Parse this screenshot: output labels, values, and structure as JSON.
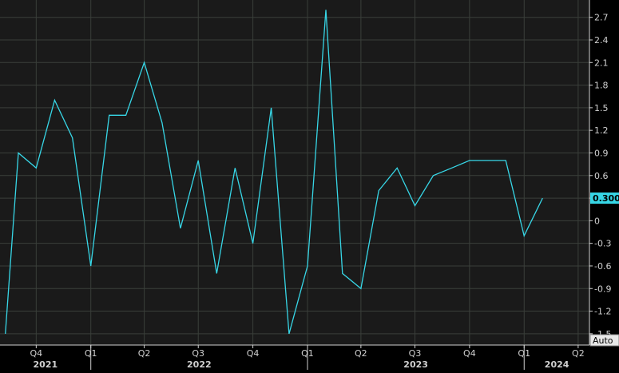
{
  "colors": {
    "background": "#000000",
    "plot_background": "#1a1a1a",
    "grid": "#3a3f3a",
    "series": "#37d6e6",
    "axis_text": "#d0d0d0",
    "badge_text": "#000000"
  },
  "last_value_label": "0.300",
  "auto_button_label": "Auto",
  "chart_data": {
    "type": "line",
    "x_type": "date",
    "x": [
      "2021-08-10",
      "2021-09-01",
      "2021-10-01",
      "2021-11-01",
      "2021-12-01",
      "2022-01-01",
      "2022-02-01",
      "2022-03-01",
      "2022-04-01",
      "2022-05-01",
      "2022-06-01",
      "2022-07-01",
      "2022-08-01",
      "2022-09-01",
      "2022-10-01",
      "2022-11-01",
      "2022-12-01",
      "2023-01-01",
      "2023-02-01",
      "2023-03-01",
      "2023-04-01",
      "2023-05-01",
      "2023-06-01",
      "2023-07-01",
      "2023-08-01",
      "2023-09-01",
      "2023-10-01",
      "2023-11-01",
      "2023-12-01",
      "2024-01-01",
      "2024-02-01"
    ],
    "series": [
      {
        "values": [
          -1.5,
          0.9,
          0.7,
          1.6,
          1.1,
          -0.6,
          1.4,
          1.4,
          2.1,
          1.3,
          -0.1,
          0.8,
          -0.7,
          0.7,
          -0.3,
          1.5,
          -1.5,
          -0.6,
          2.8,
          -0.7,
          -0.9,
          0.4,
          0.7,
          0.2,
          0.6,
          0.7,
          0.8,
          null,
          0.8,
          -0.2,
          0.3
        ]
      }
    ],
    "xlim": [
      "2021-08-01",
      "2024-04-20"
    ],
    "ylim": [
      -1.65,
      2.93
    ],
    "y_ticks": [
      2.7,
      2.4,
      2.1,
      1.8,
      1.5,
      1.2,
      0.9,
      0.6,
      0.3,
      0,
      -0.3,
      -0.6,
      -0.9,
      -1.2,
      -1.5
    ],
    "y_tick_labels": [
      "2.7",
      "2.4",
      "2.1",
      "1.8",
      "1.5",
      "1.2",
      "0.9",
      "0.6",
      "0.3",
      "0",
      "-0.3",
      "-0.6",
      "-0.9",
      "-1.2",
      "-1.5"
    ],
    "quarter_ticks": [
      {
        "date": "2021-07-01",
        "label": "Q3"
      },
      {
        "date": "2021-10-01",
        "label": "Q4"
      },
      {
        "date": "2022-01-01",
        "label": "Q1"
      },
      {
        "date": "2022-04-01",
        "label": "Q2"
      },
      {
        "date": "2022-07-01",
        "label": "Q3"
      },
      {
        "date": "2022-10-01",
        "label": "Q4"
      },
      {
        "date": "2023-01-01",
        "label": "Q1"
      },
      {
        "date": "2023-04-01",
        "label": "Q2"
      },
      {
        "date": "2023-07-01",
        "label": "Q3"
      },
      {
        "date": "2023-10-01",
        "label": "Q4"
      },
      {
        "date": "2024-01-01",
        "label": "Q1"
      },
      {
        "date": "2024-04-01",
        "label": "Q2"
      }
    ],
    "year_labels": [
      {
        "year": "2021"
      },
      {
        "year": "2022"
      },
      {
        "year": "2023"
      },
      {
        "year": "2024"
      }
    ],
    "grid": true,
    "y_axis_position": "right"
  }
}
